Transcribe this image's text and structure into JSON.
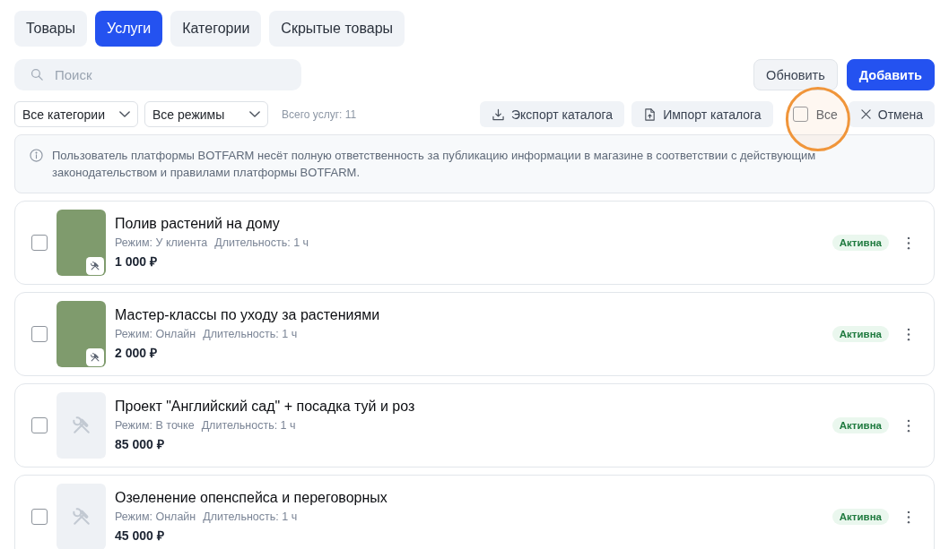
{
  "tabs": [
    {
      "label": "Товары",
      "selected": false
    },
    {
      "label": "Услуги",
      "selected": true
    },
    {
      "label": "Категории",
      "selected": false
    },
    {
      "label": "Скрытые товары",
      "selected": false
    }
  ],
  "search": {
    "placeholder": "Поиск"
  },
  "actions": [
    {
      "label": "Обновить",
      "kind": "refresh"
    },
    {
      "label": "Добавить",
      "kind": "add"
    }
  ],
  "filters": [
    {
      "value": "Все категории"
    },
    {
      "value": "Все режимы"
    }
  ],
  "total": "Всего услуг: 11",
  "catalog_buttons": [
    {
      "label": "Экспорт каталога",
      "kind": "export"
    },
    {
      "label": "Импорт каталога",
      "kind": "import"
    }
  ],
  "select_all": {
    "label": "Все",
    "checked": false,
    "highlighted": true
  },
  "cancel": {
    "label": "Отмена"
  },
  "notice": "Пользователь платформы BOTFARM несёт полную ответственность за публикацию информации в магазине в соответствии с действующим законодательством и правилами платформы BOTFARM.",
  "services": [
    {
      "kind": "photo",
      "title": "Полив растений на дому",
      "mode": "Режим: У клиента",
      "duration": "Длительность: 1 ч",
      "price": "1 000 ₽",
      "checked": false,
      "status": "Активна"
    },
    {
      "kind": "photo",
      "title": "Мастер-классы по уходу за растениями",
      "mode": "Режим: Онлайн",
      "duration": "Длительность: 1 ч",
      "price": "2 000 ₽",
      "checked": false,
      "status": "Активна"
    },
    {
      "kind": "placeholder",
      "title": "Проект \"Английский сад\" + посадка туй и роз",
      "mode": "Режим: В точке",
      "duration": "Длительность: 1 ч",
      "price": "85 000 ₽",
      "checked": false,
      "status": "Активна"
    },
    {
      "kind": "placeholder",
      "title": "Озеленение опенспейса и переговорных",
      "mode": "Режим: Онлайн",
      "duration": "Длительность: 1 ч",
      "price": "45 000 ₽",
      "checked": false,
      "status": "Активна"
    }
  ]
}
